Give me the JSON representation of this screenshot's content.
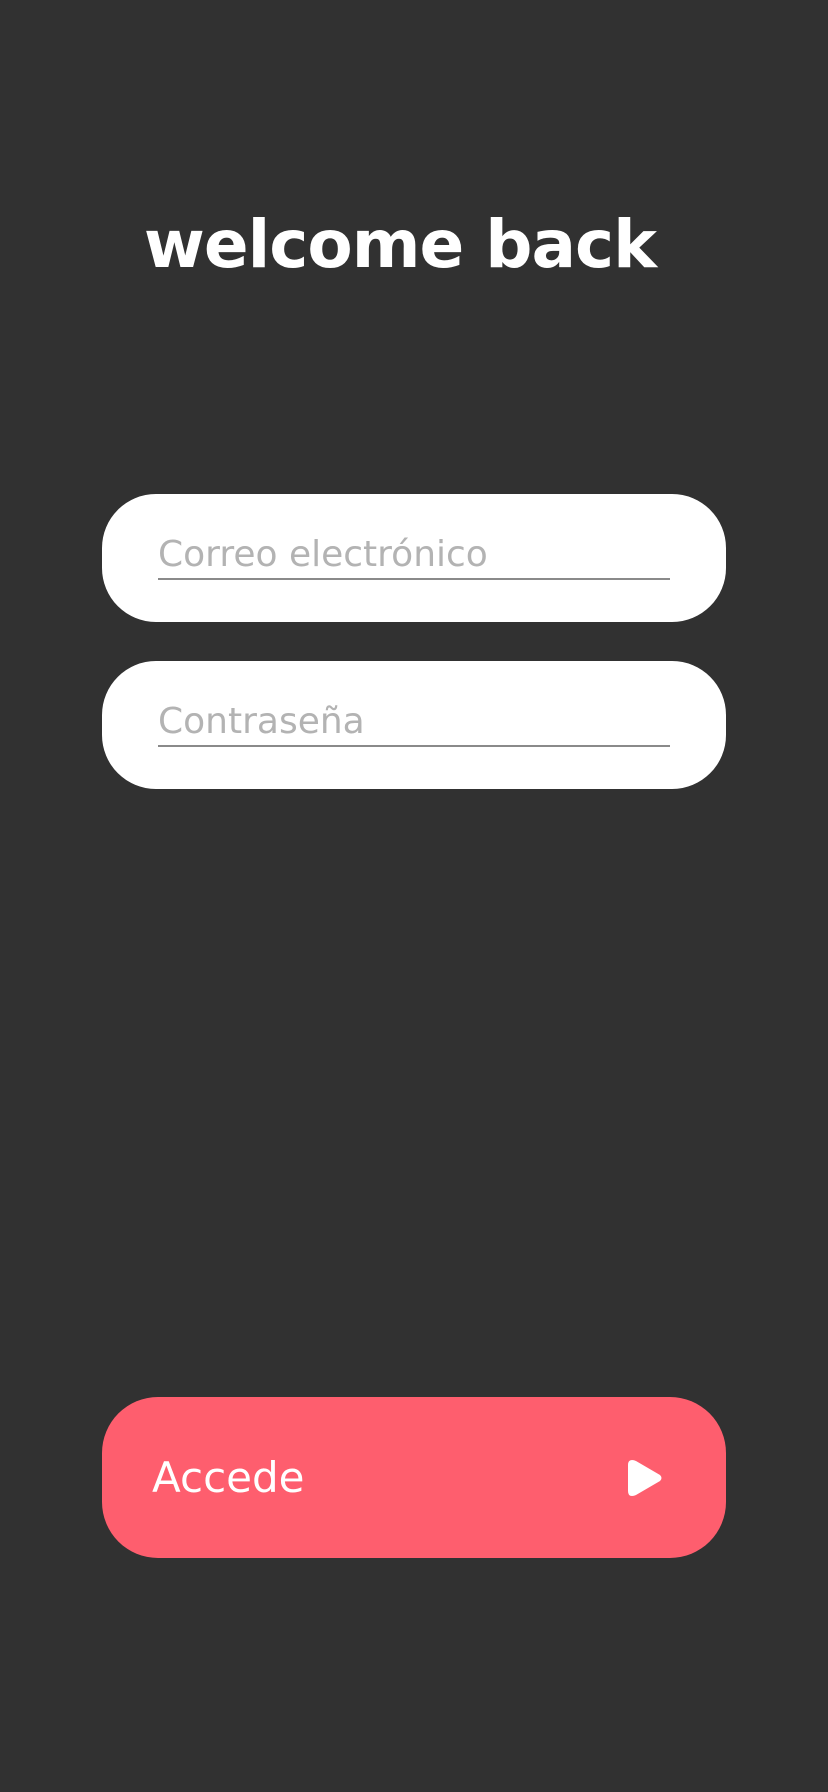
{
  "header": {
    "title": "welcome back"
  },
  "form": {
    "email": {
      "value": "",
      "placeholder": "Correo electrónico"
    },
    "password": {
      "value": "",
      "placeholder": "Contraseña"
    },
    "submit": {
      "label": "Accede",
      "icon": "play-icon"
    }
  },
  "colors": {
    "background": "#313131",
    "field_background": "#ffffff",
    "accent": "#fe5e6e",
    "placeholder": "#b3b3b3"
  }
}
